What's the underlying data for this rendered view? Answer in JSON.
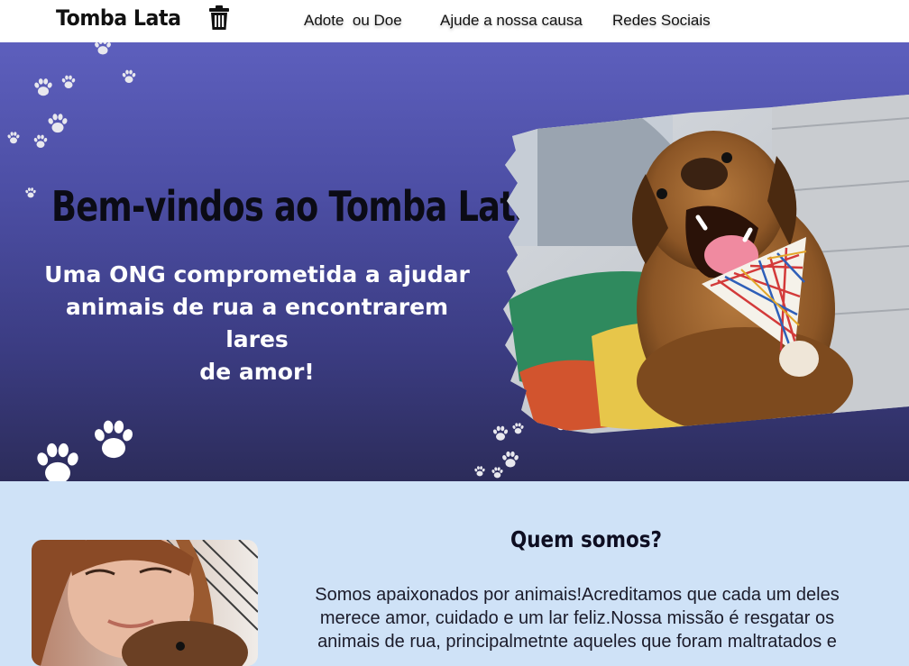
{
  "header": {
    "brand": "Tomba Lata",
    "brand_icon": "trash-icon",
    "nav": [
      "Adote  ou Doe",
      "Ajude a nossa causa",
      "Redes Sociais"
    ]
  },
  "hero": {
    "title": "Bem-vindos ao Tomba Lata",
    "subtitle_lines": [
      "Uma ONG comprometida a ajudar",
      "animais de rua a encontrarem lares",
      "de amor!"
    ],
    "image": "dog-with-bandana-photo",
    "decoration_icon": "paw-icon"
  },
  "about": {
    "title": "Quem somos?",
    "text_lines": [
      "Somos apaixonados por animais!Acreditamos que cada um deles",
      "merece amor, cuidado e um lar feliz.Nossa missão é resgatar os",
      "animais de rua, principalmetnte aqueles que foram maltratados e"
    ],
    "image": "volunteer-with-dog-photo"
  },
  "colors": {
    "hero_top": "#5d5fbd",
    "hero_bottom": "#2c2c5a",
    "about_bg": "#cfe2f7",
    "header_bg": "#ffffff"
  }
}
